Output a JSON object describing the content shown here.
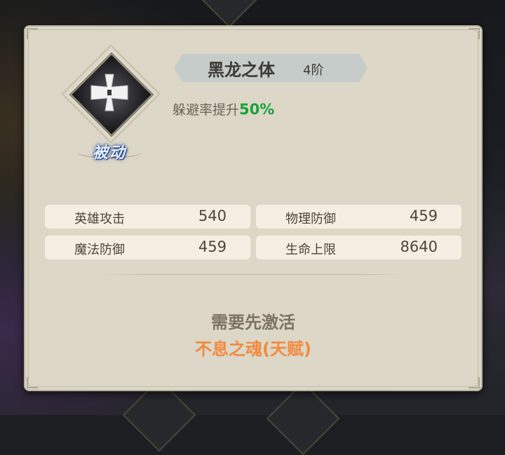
{
  "skill": {
    "name": "黑龙之体",
    "rank": "4阶",
    "type_label": "被动",
    "icon": "iron-cross-icon",
    "effect_text": "躲避率提升",
    "effect_value": "50%"
  },
  "stats": [
    {
      "label": "英雄攻击",
      "value": "540"
    },
    {
      "label": "物理防御",
      "value": "459"
    },
    {
      "label": "魔法防御",
      "value": "459"
    },
    {
      "label": "生命上限",
      "value": "8640"
    }
  ],
  "requirement": {
    "title": "需要先激活",
    "item": "不息之魂(天赋)"
  },
  "colors": {
    "panel": "#dcd7c7",
    "effect_value": "#18a23a",
    "requirement_item": "#f38a3e",
    "passive_label": "#eaf1ff"
  }
}
